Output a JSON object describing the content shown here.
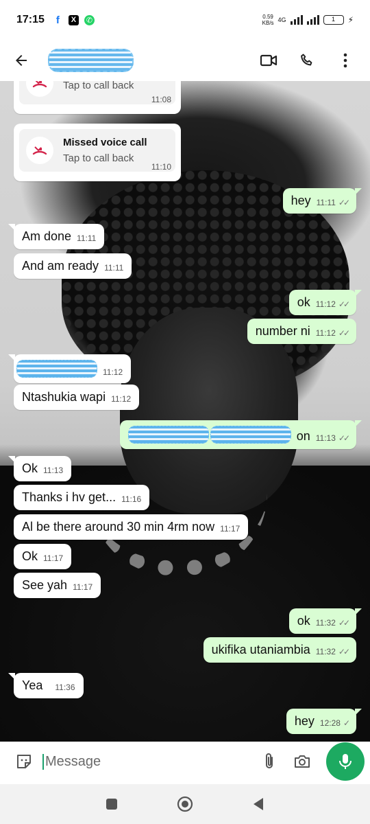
{
  "status_bar": {
    "time": "17:15",
    "net_speed_value": "0.59",
    "net_speed_unit": "KB/s",
    "network_type": "4G",
    "battery": "1"
  },
  "header": {
    "contact_name": ""
  },
  "calls": [
    {
      "title": "",
      "subtitle": "Tap to call back",
      "time": "11:08"
    },
    {
      "title": "Missed voice call",
      "subtitle": "Tap to call back",
      "time": "11:10"
    }
  ],
  "messages": [
    {
      "dir": "out",
      "text": "hey",
      "time": "11:11"
    },
    {
      "dir": "in",
      "text": "Am done",
      "time": "11:11"
    },
    {
      "dir": "in",
      "text": "And am ready",
      "time": "11:11"
    },
    {
      "dir": "out",
      "text": "ok",
      "time": "11:12"
    },
    {
      "dir": "out",
      "text": "number ni",
      "time": "11:12"
    },
    {
      "dir": "in",
      "text": "",
      "time": "11:12"
    },
    {
      "dir": "in",
      "text": "Ntashukia wapi",
      "time": "11:12"
    },
    {
      "dir": "out",
      "text": "on",
      "time": "11:13"
    },
    {
      "dir": "in",
      "text": "Ok",
      "time": "11:13"
    },
    {
      "dir": "in",
      "text": "Thanks i hv get...",
      "time": "11:16"
    },
    {
      "dir": "in",
      "text": "Al be there around 30 min 4rm now",
      "time": "11:17"
    },
    {
      "dir": "in",
      "text": "Ok",
      "time": "11:17"
    },
    {
      "dir": "in",
      "text": "See yah",
      "time": "11:17"
    },
    {
      "dir": "out",
      "text": "ok",
      "time": "11:32"
    },
    {
      "dir": "out",
      "text": "ukifika utaniambia",
      "time": "11:32"
    },
    {
      "dir": "in",
      "text": "Yea",
      "time": "11:36"
    },
    {
      "dir": "out",
      "text": "hey",
      "time": "12:28"
    }
  ],
  "input": {
    "placeholder": "Message"
  },
  "colors": {
    "outgoing_bubble": "#d9fdd3",
    "incoming_bubble": "#ffffff",
    "accent_green": "#1daa61",
    "missed_call_red": "#d3234a"
  },
  "icons": {
    "header": [
      "back-arrow-icon",
      "video-call-icon",
      "voice-call-icon",
      "more-options-icon"
    ],
    "input": [
      "sticker-icon",
      "attach-icon",
      "camera-icon",
      "mic-icon"
    ],
    "nav": [
      "recent-apps-icon",
      "home-icon",
      "back-icon"
    ]
  }
}
